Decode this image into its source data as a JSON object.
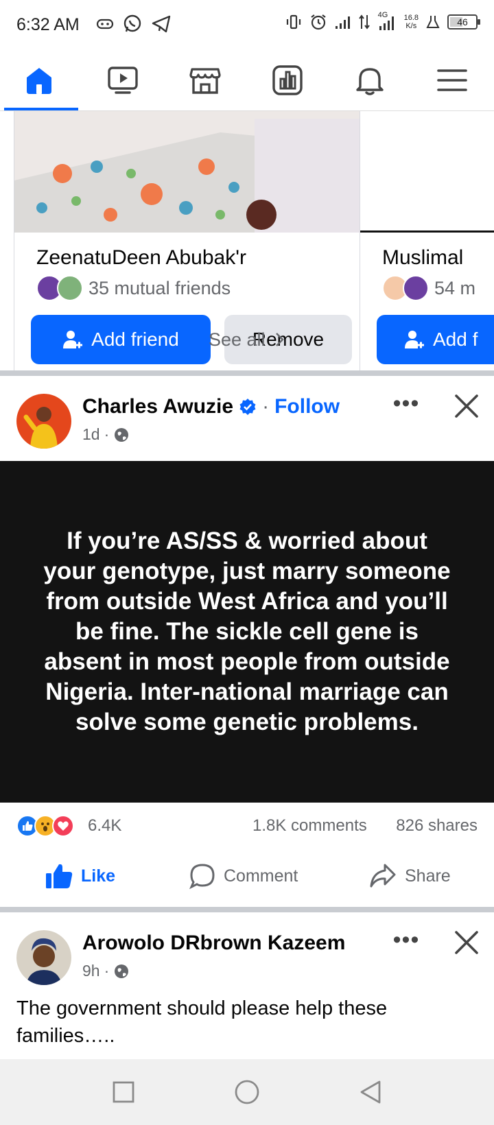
{
  "status_bar": {
    "time": "6:32 AM",
    "speed_value": "16.8",
    "speed_unit": "K/s",
    "network": "4G",
    "battery": "46",
    "icons": [
      "gamepad-icon",
      "whatsapp-icon",
      "telegram-icon",
      "vibrate-icon",
      "alarm-icon",
      "signal-icon",
      "data-arrows-icon",
      "signal-4g-icon",
      "lab-icon",
      "battery-icon"
    ]
  },
  "nav": {
    "tabs": [
      {
        "name": "home",
        "icon": "home-icon",
        "active": true
      },
      {
        "name": "video",
        "icon": "video-icon",
        "active": false
      },
      {
        "name": "marketplace",
        "icon": "marketplace-icon",
        "active": false
      },
      {
        "name": "feeds",
        "icon": "feeds-icon",
        "active": false
      },
      {
        "name": "notifications",
        "icon": "bell-icon",
        "active": false
      },
      {
        "name": "menu",
        "icon": "menu-icon",
        "active": false
      }
    ],
    "accent": "#0866ff"
  },
  "suggestions": {
    "cards": [
      {
        "name": "ZeenatuDeen Abubak'r",
        "mutual": "35 mutual friends",
        "add_label": "Add friend",
        "remove_label": "Remove"
      },
      {
        "name": "Muslimal",
        "mutual": "54 m",
        "add_label": "Add f"
      }
    ],
    "see_all": "See all"
  },
  "post1": {
    "author": "Charles Awuzie",
    "separator": "·",
    "follow": "Follow",
    "time": "1d",
    "meta_sep": "·",
    "more": "•••",
    "quote": "If you’re AS/SS & worried about your genotype, just marry someone from outside West Africa and you’ll be fine. The sickle cell gene is absent in most people from outside Nigeria. Inter-national marriage can solve some genetic problems.",
    "reactions_count": "6.4K",
    "comments": "1.8K comments",
    "shares": "826 shares",
    "actions": {
      "like": "Like",
      "comment": "Comment",
      "share": "Share"
    }
  },
  "post2": {
    "author": "Arowolo DRbrown Kazeem",
    "time": "9h",
    "meta_sep": "·",
    "more": "•••",
    "text": "The government should please help these families….."
  }
}
